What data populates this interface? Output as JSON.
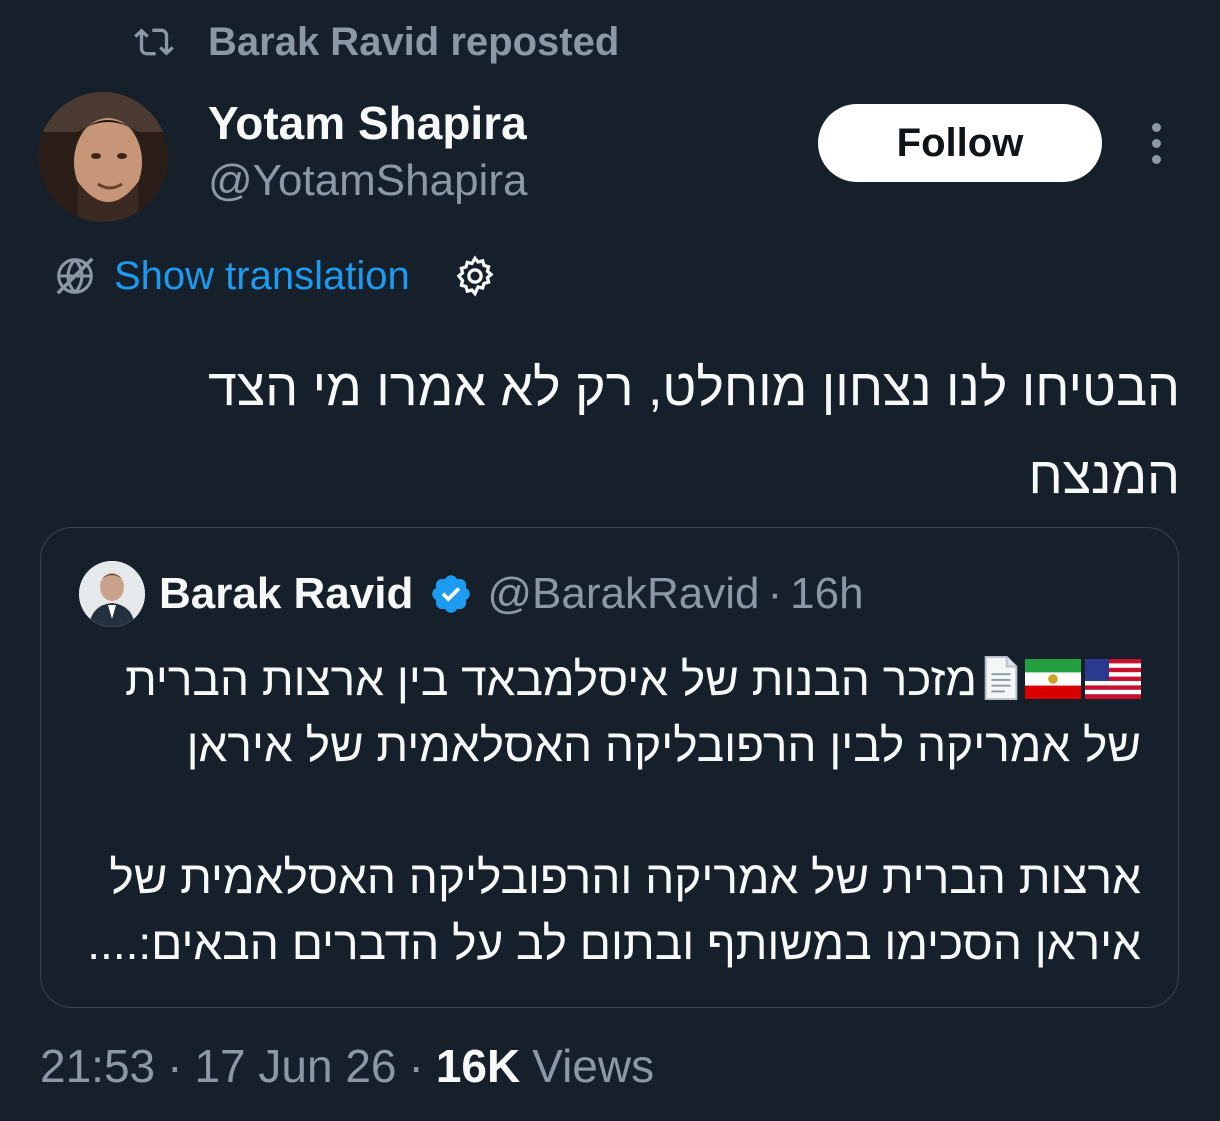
{
  "repost": {
    "icon": "repost-icon",
    "text": "Barak Ravid reposted"
  },
  "author": {
    "display_name": "Yotam Shapira",
    "handle": "@YotamShapira"
  },
  "follow_label": "Follow",
  "translation": {
    "label": "Show translation",
    "globe_icon": "globe-icon",
    "settings_icon": "gear-icon"
  },
  "tweet": {
    "line1": "הבטיחו לנו נצחון מוחלט, רק לא אמרו מי הצד",
    "line2": "המנצח"
  },
  "quote": {
    "display_name": "Barak Ravid",
    "handle": "@BarakRavid",
    "separator": "·",
    "time": "16h",
    "line1": "מזכר הבנות של איסלמבאד בין ארצות הברית",
    "line2": "של אמריקה לבין הרפובליקה האסלאמית של איראן",
    "line3": "ארצות הברית של אמריקה והרפובליקה האסלאמית של",
    "line4": "איראן הסכימו במשותף ובתום לב על הדברים הבאים:...."
  },
  "meta": {
    "time": "21:53",
    "date": "17 Jun 26",
    "separator": "·",
    "views_count": "16K",
    "views_label": "Views"
  },
  "colors": {
    "background": "#15202b",
    "link": "#1d9bf0",
    "muted": "#8b98a5",
    "text": "#f7f9f9",
    "verified": "#1d9bf0"
  }
}
